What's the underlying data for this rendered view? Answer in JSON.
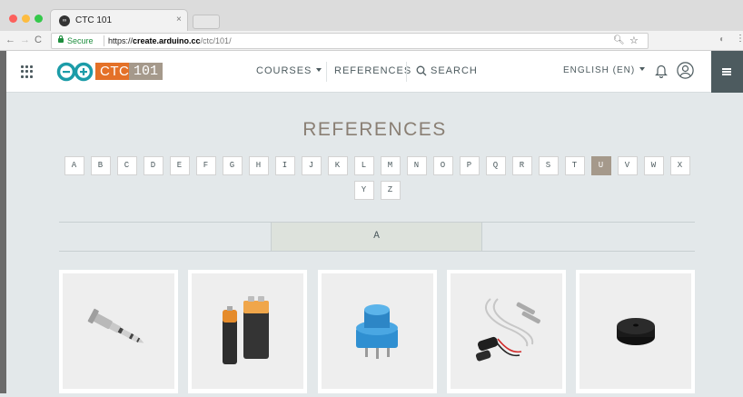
{
  "browser": {
    "tab_title": "CTC 101",
    "tab_close": "×",
    "secure_label": "Secure",
    "url_scheme": "https://",
    "url_domain": "create.arduino.cc",
    "url_path": "/ctc/101/"
  },
  "header": {
    "brand_ctc": "CTC",
    "brand_101": "101",
    "nav": {
      "courses": "COURSES",
      "references": "REFERENCES",
      "search": "SEARCH",
      "language": "ENGLISH (EN)"
    },
    "icons": [
      "apps-icon",
      "arduino-logo",
      "search-icon",
      "bell-icon",
      "user-icon",
      "hamburger-icon"
    ]
  },
  "main": {
    "title": "REFERENCES",
    "letters": [
      "A",
      "B",
      "C",
      "D",
      "E",
      "F",
      "G",
      "H",
      "I",
      "J",
      "K",
      "L",
      "M",
      "N",
      "O",
      "P",
      "Q",
      "R",
      "S",
      "T",
      "U",
      "V",
      "W",
      "X",
      "Y",
      "Z"
    ],
    "active_letter": "U",
    "section_tab": "A",
    "cards": [
      {
        "icon": "audio-jack-icon"
      },
      {
        "icon": "batteries-icon"
      },
      {
        "icon": "potentiometer-icon"
      },
      {
        "icon": "battery-snap-icon"
      },
      {
        "icon": "piezo-buzzer-icon"
      }
    ]
  },
  "colors": {
    "accent_orange": "#e47128",
    "brand_taupe": "#a5998b",
    "header_dark": "#4d5b5f",
    "page_bg": "#e3e8ea"
  }
}
